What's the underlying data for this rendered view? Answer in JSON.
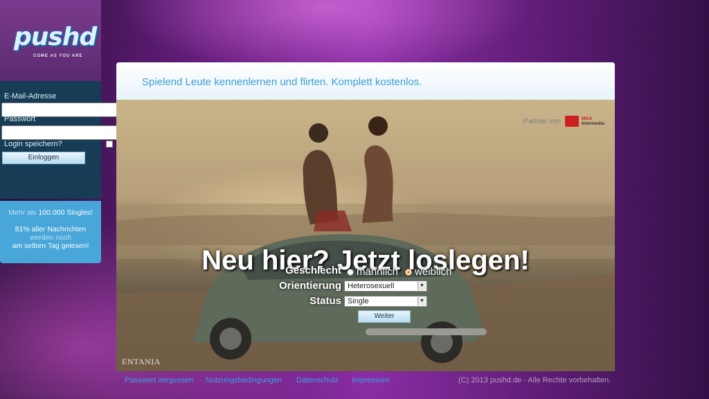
{
  "brand": {
    "logo_text": "pushd",
    "tagline": "COME AS YOU ARE"
  },
  "login": {
    "email_label": "E-Mail-Adresse",
    "email_value": "",
    "password_label": "Passwort",
    "password_value": "",
    "remember_label": "Login speichern?",
    "remember_checked": false,
    "submit_label": "Einloggen"
  },
  "info": {
    "line1_prefix": "Mehr als",
    "line1_highlight": "100.000 Singles!",
    "line2": "81% aller Nachrichten",
    "line3": "werden noch",
    "line4": "am selben Tag gelesen!"
  },
  "main": {
    "tagline": "Spielend Leute kennenlernen und flirten. Komplett kostenlos.",
    "partner_label": "Partner von",
    "partner_logo": [
      "MGA",
      "Intermedia"
    ],
    "headline": "Neu hier? Jetzt loslegen!",
    "photo_credit": "ENTANIA"
  },
  "form": {
    "gender_label": "Geschlecht",
    "gender_options": [
      {
        "label": "männlich",
        "checked": false
      },
      {
        "label": "weiblich",
        "checked": true
      }
    ],
    "orientation_label": "Orientierung",
    "orientation_value": "Heterosexuell",
    "status_label": "Status",
    "status_value": "Single",
    "submit_label": "Weiter"
  },
  "footer": {
    "links": [
      "Passwort vergessen",
      "Nutzungsbedingungen",
      "Datenschutz",
      "Impressum"
    ],
    "copyright": "(C) 2013 pushd.de - Alle Rechte vorbehalten."
  },
  "colors": {
    "accent": "#3a9fd6",
    "sidebar_dark": "#163d55",
    "info_blue": "#48a6d9",
    "radio_checked": "#e57a14"
  }
}
